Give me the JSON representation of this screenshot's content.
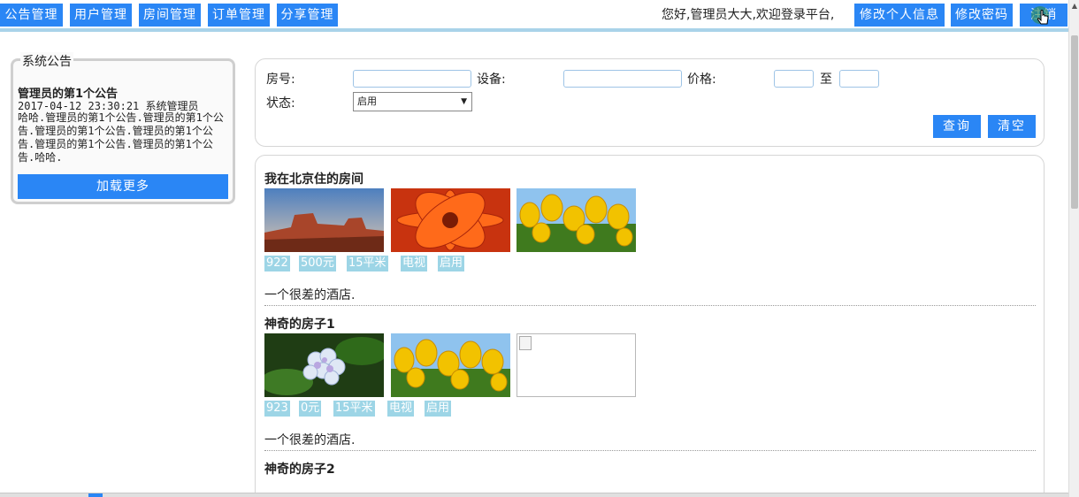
{
  "nav": {
    "items": [
      {
        "label": "公告管理"
      },
      {
        "label": "用户管理"
      },
      {
        "label": "房间管理"
      },
      {
        "label": "订单管理"
      },
      {
        "label": "分享管理"
      }
    ],
    "welcome": "您好,管理员大大,欢迎登录平台,",
    "edit_profile": "修改个人信息",
    "change_password": "修改密码",
    "logout": "注销"
  },
  "notice": {
    "legend": "系统公告",
    "title": "管理员的第1个公告",
    "meta": "2017-04-12 23:30:21 系统管理员",
    "body": "哈哈.管理员的第1个公告.管理员的第1个公告.管理员的第1个公告.管理员的第1个公告.管理员的第1个公告.管理员的第1个公告.哈哈.",
    "load_more": "加载更多"
  },
  "search": {
    "room_no_label": "房号:",
    "room_no_value": "",
    "device_label": "设备:",
    "device_value": "",
    "price_label": "价格:",
    "price_min": "",
    "price_to": "至",
    "price_max": "",
    "status_label": "状态:",
    "status_selected": "启用",
    "query_button": "查询",
    "clear_button": "清空"
  },
  "rooms": [
    {
      "title": "我在北京住的房间",
      "photos": [
        "desert-image",
        "red-flower-image",
        "yellow-tulips-image"
      ],
      "tags": [
        "922",
        "500元",
        "15平米",
        "电视",
        "启用"
      ],
      "desc": "一个很差的酒店."
    },
    {
      "title": "神奇的房子1",
      "photos": [
        "hydrangea-image",
        "yellow-tulips-image",
        "broken-image"
      ],
      "tags": [
        "923",
        "0元",
        "15平米",
        "电视",
        "启用"
      ],
      "desc": "一个很差的酒店."
    },
    {
      "title": "神奇的房子2",
      "photos": [],
      "tags": [],
      "desc": ""
    }
  ],
  "colors": {
    "accent": "#2a86f5",
    "tag_bg": "#9dd5e6",
    "nav_underline": "#a9d3e9"
  }
}
